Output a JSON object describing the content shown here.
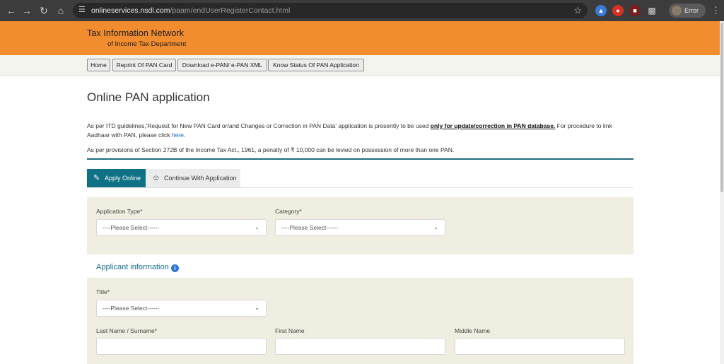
{
  "browser": {
    "url_host": "onlineservices.nsdl.com",
    "url_path": "/paam/endUserRegisterContact.html",
    "profile_status": "Error",
    "icons": [
      "back-icon",
      "forward-icon",
      "reload-icon",
      "home-icon",
      "site-info-icon",
      "bookmark-star-icon",
      "extension-icon",
      "menu-icon"
    ]
  },
  "header": {
    "brand_line1": "Tax Information Network",
    "brand_line2": "of Income Tax Department",
    "bg_color": "#f28d2f"
  },
  "nav": {
    "items": [
      {
        "label": "Home"
      },
      {
        "label": "Reprint Of PAN Card"
      },
      {
        "label": "Download e-PAN/ e-PAN XML"
      },
      {
        "label": "Know Status Of PAN Application"
      }
    ]
  },
  "page": {
    "title": "Online PAN application",
    "para1_before": "As per ITD guidelines,'Request for New PAN Card or/and Changes or Correction in PAN Data' application is presently to be used ",
    "para1_bold": "only for update/correction in PAN database.",
    "para1_after": " For procedure to link",
    "para1_line2": "Aadhaar with PAN, please click ",
    "para1_link": "here",
    "para1_end": ".",
    "para2": "As per provisions of Section 272B of the Income Tax Act., 1961, a penalty of ₹ 10,000 can be levied on possession of more than one PAN."
  },
  "tabs": [
    {
      "label": "Apply Online",
      "active": true
    },
    {
      "label": "Continue With Application",
      "active": false
    }
  ],
  "form": {
    "application_type": {
      "label": "Application Type*",
      "value": "----Please Select------"
    },
    "category": {
      "label": "Category*",
      "value": "----Please Select------"
    },
    "section_title": "Applicant information",
    "title_field": {
      "label": "Title*",
      "value": "----Please Select------"
    },
    "last_name": {
      "label": "Last Name / Surname*",
      "value": ""
    },
    "first_name": {
      "label": "First Name",
      "value": ""
    },
    "middle_name": {
      "label": "Middle Name",
      "value": ""
    }
  },
  "colors": {
    "accent_tab": "#0f7186",
    "panel_bg": "#efeee0",
    "section_title": "#1a6e92"
  }
}
